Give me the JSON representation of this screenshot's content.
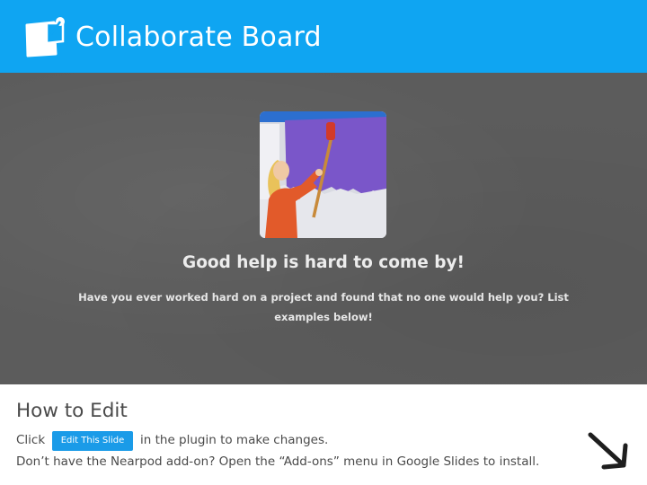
{
  "header": {
    "title": "Collaborate Board",
    "background": "#0fa5f2",
    "logo_icon": "collaborate-board-icon"
  },
  "board": {
    "title": "Good help is hard to come by!",
    "question": "Have you ever worked hard on a project and found that no one would help you? List examples below!",
    "image": "woman-painting-wall-photo",
    "background": "#5c5c5c"
  },
  "instructions": {
    "heading": "How to Edit",
    "click_text": "Click",
    "button_label": "Edit This Slide",
    "after_button": "in the plugin to make changes.",
    "addon_text": "Don’t have the Nearpod add-on? Open the “Add-ons” menu in Google Slides to install.",
    "arrow_icon": "arrow-down-right-icon",
    "button_color": "#1a9be8"
  }
}
